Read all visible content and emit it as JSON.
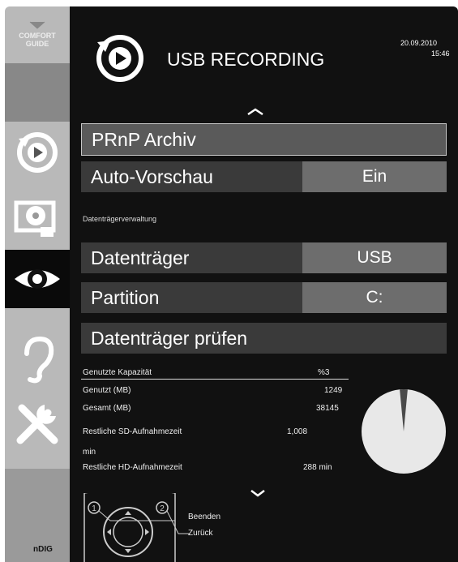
{
  "sidebar": {
    "comfort_guide": [
      "COMFORT",
      "GUIDE"
    ],
    "brand": "nDIG",
    "icons": [
      "recording-icon",
      "media-icon",
      "eye-icon",
      "ear-icon",
      "tools-icon"
    ],
    "active_index": 2
  },
  "header": {
    "title": "USB RECORDING",
    "date": "20.09.2010",
    "time": "15:46"
  },
  "menu": {
    "archive_label": "PRnP Archiv",
    "autopreview_label": "Auto-Vorschau",
    "autopreview_value": "Ein",
    "section_label": "Datenträgerverwaltung",
    "device_label": "Datenträger",
    "device_value": "USB",
    "partition_label": "Partition",
    "partition_value": "C:",
    "check_label": "Datenträger prüfen"
  },
  "capacity": {
    "used_capacity_label": "Genutzte Kapazität",
    "used_capacity_value": "%3",
    "used_mb_label": "Genutzt (MB)",
    "used_mb_value": "1249",
    "total_mb_label": "Gesamt (MB)",
    "total_mb_value": "38145",
    "sd_label": "Restliche SD-Aufnahmezeit",
    "sd_value": "1,008",
    "sd_unit": "min",
    "hd_label": "Restliche HD-Aufnahmezeit",
    "hd_value": "288 min",
    "used_fraction": 0.03
  },
  "footer": {
    "exit_label": "Beenden",
    "back_label": "Zurück",
    "key1": "1",
    "key2": "2"
  },
  "colors": {
    "background": "#111111",
    "sidebar": "#b9b9b9",
    "row": "#3a3a3a",
    "value_box": "#6d6d6d",
    "pie_free": "#e8e8e8",
    "pie_used": "#4a4a4a"
  }
}
